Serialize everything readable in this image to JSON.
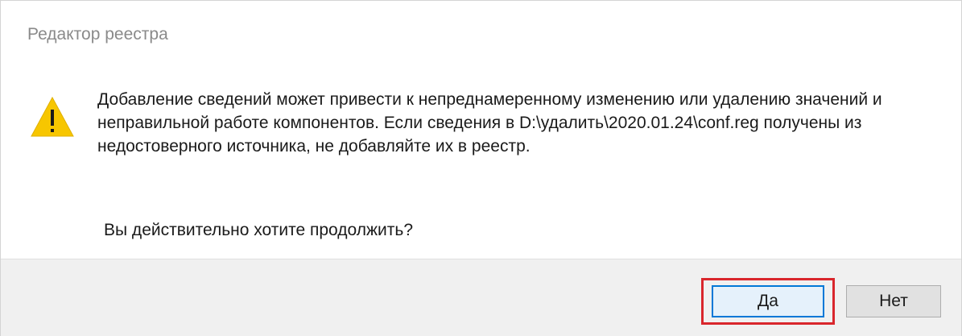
{
  "window": {
    "title": "Редактор реестра"
  },
  "message": {
    "text": "Добавление сведений может привести к непреднамеренному изменению или удалению значений и неправильной работе компонентов. Если сведения в D:\\удалить\\2020.01.24\\conf.reg получены из недостоверного источника, не добавляйте их в реестр.",
    "question": "Вы действительно хотите продолжить?"
  },
  "icon": {
    "name": "warning-icon",
    "color": "#f7c600"
  },
  "buttons": {
    "yes_label": "Да",
    "no_label": "Нет"
  },
  "colors": {
    "highlight": "#d9262c",
    "focus": "#0078d7"
  }
}
